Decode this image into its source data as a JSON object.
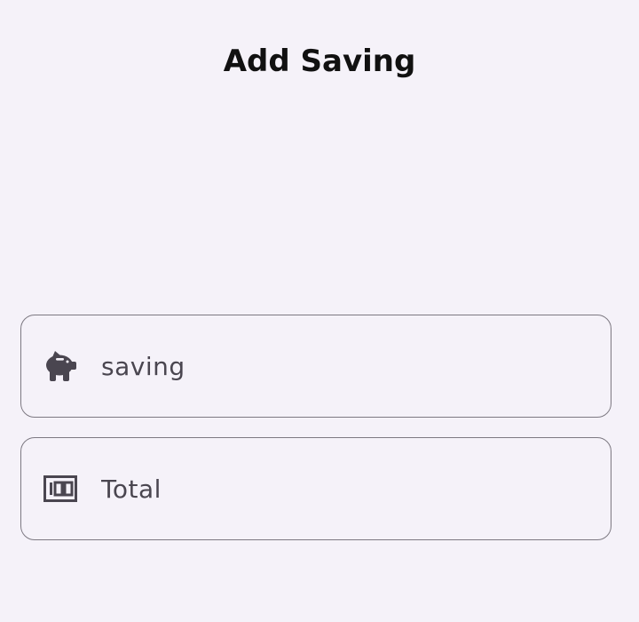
{
  "page": {
    "title": "Add Saving"
  },
  "form": {
    "saving_field": {
      "icon": "piggy-bank-icon",
      "placeholder": "saving",
      "value": ""
    },
    "total_field": {
      "icon": "money-bill-100-icon",
      "placeholder": "Total",
      "value": ""
    }
  },
  "colors": {
    "background": "#f5f2f9",
    "outline": "#7d7982",
    "icon": "#4a4650",
    "title": "#111111"
  }
}
